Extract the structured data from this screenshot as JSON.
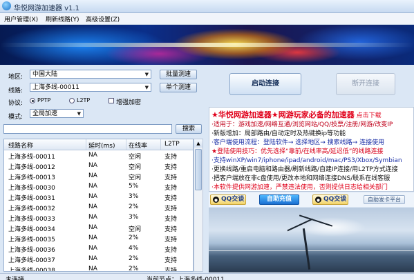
{
  "window": {
    "title": "华悦网游加速器 v1.1"
  },
  "menu": {
    "items": [
      "用户管理(X)",
      "刷新线路(Y)",
      "高级设置(Z)"
    ]
  },
  "controls": {
    "region_label": "地区:",
    "region_value": "中国大陆",
    "batch_test_label": "批量测速",
    "line_label": "线路:",
    "line_value": "上海多线-00011",
    "single_test_label": "单个测速",
    "protocol_label": "协议:",
    "protocol_pptp": "PPTP",
    "protocol_l2tp": "L2TP",
    "protocol_selected": "PPTP",
    "enhanced_encryption_label": "增强加密",
    "enhanced_encryption_checked": false,
    "mode_label": "模式:",
    "mode_value": "全局加速",
    "search_value": "",
    "search_label": "搜索"
  },
  "table": {
    "columns": [
      "线路名称",
      "延时(ms)",
      "在线率",
      "L2TP"
    ],
    "rows": [
      [
        "上海多线-00011",
        "NA",
        "空闲",
        "支持"
      ],
      [
        "上海多线-00012",
        "NA",
        "空闲",
        "支持"
      ],
      [
        "上海多线-00013",
        "NA",
        "空闲",
        "支持"
      ],
      [
        "上海多线-00030",
        "NA",
        "5%",
        "支持"
      ],
      [
        "上海多线-00031",
        "NA",
        "3%",
        "支持"
      ],
      [
        "上海多线-00032",
        "NA",
        "2%",
        "支持"
      ],
      [
        "上海多线-00033",
        "NA",
        "3%",
        "支持"
      ],
      [
        "上海多线-00034",
        "NA",
        "空闲",
        "支持"
      ],
      [
        "上海多线-00035",
        "NA",
        "2%",
        "支持"
      ],
      [
        "上海多线-00036",
        "NA",
        "4%",
        "支持"
      ],
      [
        "上海多线-00037",
        "NA",
        "2%",
        "支持"
      ],
      [
        "上海多线-00038",
        "NA",
        "2%",
        "支持"
      ]
    ]
  },
  "right": {
    "connect_label": "启动连接",
    "disconnect_label": "断开连接",
    "notice_lines": [
      {
        "parts": [
          {
            "text": "★华悦网游加速器★网游玩家必备的加速器",
            "color": "#e0001a",
            "size": 11,
            "bold": true
          },
          {
            "text": " 点击下载",
            "color": "#e0001a"
          }
        ]
      },
      {
        "parts": [
          {
            "text": "·适用于：游戏加速/网络互通/浏览网站/QQ/投票/注册/网游/改变IP",
            "color": "#c0001a"
          }
        ]
      },
      {
        "parts": [
          {
            "text": "·新版增加：局部路由/自动定时及热键换ip等功能",
            "color": "#111111"
          }
        ]
      },
      {
        "parts": [
          {
            "text": "·客户端使用流程：登陆软件→ 选择地区→ 搜索线路→ 连接使用",
            "color": "#1b2fa6"
          }
        ]
      },
      {
        "parts": [
          {
            "text": "★登陆使用技巧：优先选择“靠前/在线率高/延迟低”的线路连接",
            "color": "#d8001a"
          }
        ]
      },
      {
        "parts": [
          {
            "text": "·支持winXP/win7/iphone/ipad/android/mac/PS3/Xbox/Symbian",
            "color": "#1b2fa6"
          }
        ]
      },
      {
        "parts": [
          {
            "text": "·更换线路/重启电脑和路由器/刷新线路/自建IP连接/用L2TP方式连接",
            "color": "#111111"
          }
        ]
      },
      {
        "parts": [
          {
            "text": "·把客户端放在非c盘使用/更改本地和网络连接DNS/联系在线客服",
            "color": "#111111"
          }
        ]
      },
      {
        "parts": [
          {
            "text": "·本软件提供网游加速，严禁违法使用，否则提供日志给相关部门",
            "color": "#e0001a"
          }
        ]
      }
    ],
    "qq_label_1": "QQ交谈",
    "recharge_label": "自助充值",
    "qq_label_2": "QQ交谈",
    "card_label": "自助发卡平台"
  },
  "status": {
    "left": "未连接",
    "middle": "当前节点：上海多线-00011"
  }
}
